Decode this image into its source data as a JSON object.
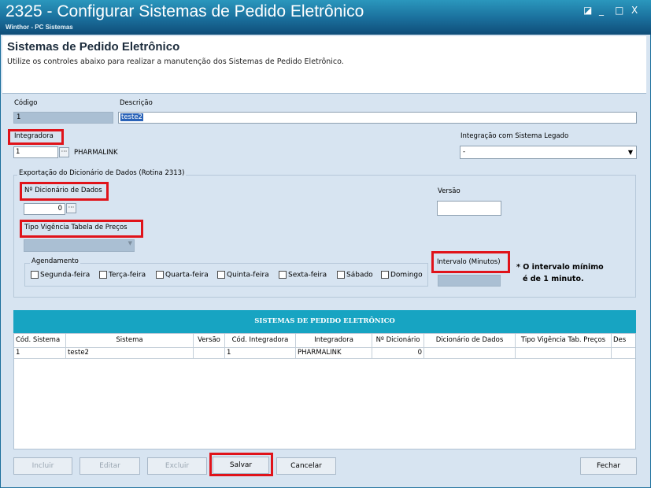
{
  "window": {
    "title": "2325 - Configurar Sistemas de Pedido Eletrônico",
    "subtitle": "Winthor - PC Sistemas",
    "controls": [
      "◪",
      "_",
      "□",
      "X"
    ]
  },
  "header": {
    "title": "Sistemas de Pedido Eletrônico",
    "description": "Utilize os controles abaixo para realizar a manutenção dos Sistemas de Pedido Eletrônico."
  },
  "form": {
    "codigo_label": "Código",
    "codigo_value": "1",
    "descricao_label": "Descrição",
    "descricao_value": "teste2",
    "integradora_label": "Integradora",
    "integradora_code": "1",
    "integradora_name": "PHARMALINK",
    "integracao_legado_label": "Integração com Sistema Legado",
    "integracao_legado_value": "-",
    "exportacao_label": "Exportação do Dicionário de Dados (Rotina 2313)",
    "dicionario_label": "Nº Dicionário de Dados",
    "dicionario_value": "0",
    "versao_label": "Versão",
    "versao_value": "",
    "tipo_vigencia_label": "Tipo Vigência Tabela de Preços",
    "tipo_vigencia_value": "",
    "agendamento_label": "Agendamento",
    "days": [
      "Segunda-feira",
      "Terça-feira",
      "Quarta-feira",
      "Quinta-feira",
      "Sexta-feira",
      "Sábado",
      "Domingo"
    ],
    "intervalo_label": "Intervalo (Minutos)",
    "intervalo_value": "",
    "intervalo_note_line1": "* O intervalo mínimo",
    "intervalo_note_line2": "é de 1 minuto.",
    "ellipsis": "···"
  },
  "grid": {
    "title": "SISTEMAS DE PEDIDO ELETRÔNICO",
    "columns": [
      "Cód. Sistema",
      "Sistema",
      "Versão",
      "Cód. Integradora",
      "Integradora",
      "Nº Dicionário",
      "Dicionário de Dados",
      "Tipo Vigência Tab. Preços",
      "Des"
    ],
    "rows": [
      [
        "1",
        "teste2",
        "",
        "1",
        "PHARMALINK",
        "0",
        "",
        "",
        ""
      ]
    ]
  },
  "buttons": {
    "incluir": "Incluir",
    "editar": "Editar",
    "excluir": "Excluir",
    "salvar": "Salvar",
    "cancelar": "Cancelar",
    "fechar": "Fechar"
  },
  "colors": {
    "highlight": "#e0131a",
    "grid_header": "#17a4c2",
    "title_bar": "#1a6e9b"
  }
}
